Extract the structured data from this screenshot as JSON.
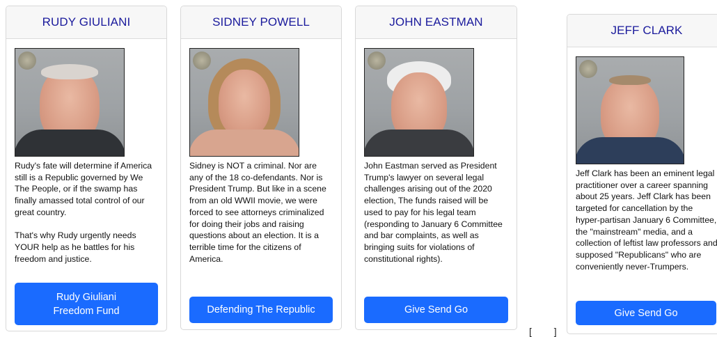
{
  "cards": [
    {
      "name": "RUDY GIULIANI",
      "description": "Rudy's fate will determine if America still is a Republic governed by We The People, or if the swamp has finally amassed total control of our great country.\n\nThat's why Rudy urgently needs YOUR help as he battles for his freedom and justice.",
      "button": "Rudy Giuliani\nFreedom Fund",
      "photo_alt": "mugshot photo"
    },
    {
      "name": "SIDNEY POWELL",
      "description": "Sidney is NOT a criminal. Nor are any of the 18 co-defendants. Nor is President Trump. But like in a scene from an old WWII movie, we were forced to see attorneys criminalized for doing their jobs and raising questions about an election. It is a terrible time for the citizens of America.",
      "button": "Defending The Republic",
      "photo_alt": "mugshot photo"
    },
    {
      "name": "JOHN EASTMAN",
      "description": "John Eastman served as President Trump's lawyer on several legal challenges arising out of the 2020 election, The funds raised will be used to pay for his legal team (responding to January 6 Committee and bar complaints, as well as bringing suits for violations of constitutional rights).",
      "button": "Give Send Go",
      "photo_alt": "mugshot photo"
    },
    {
      "name": "JEFF CLARK",
      "description": "Jeff Clark has been an eminent legal practitioner over a career spanning about 25 years. Jeff Clark has been targeted for cancellation by the hyper-partisan January 6 Committee, the \"mainstream\" media, and a collection of leftist law professors and supposed \"Republicans\" who are conveniently never-Trumpers.",
      "button": "Give Send Go",
      "photo_alt": "mugshot photo"
    }
  ],
  "footer": {
    "bracket_glyph": "[ ]"
  },
  "colors": {
    "header_text": "#1a1a9c",
    "button_bg": "#1a6bff",
    "border": "#d8d8d8"
  }
}
